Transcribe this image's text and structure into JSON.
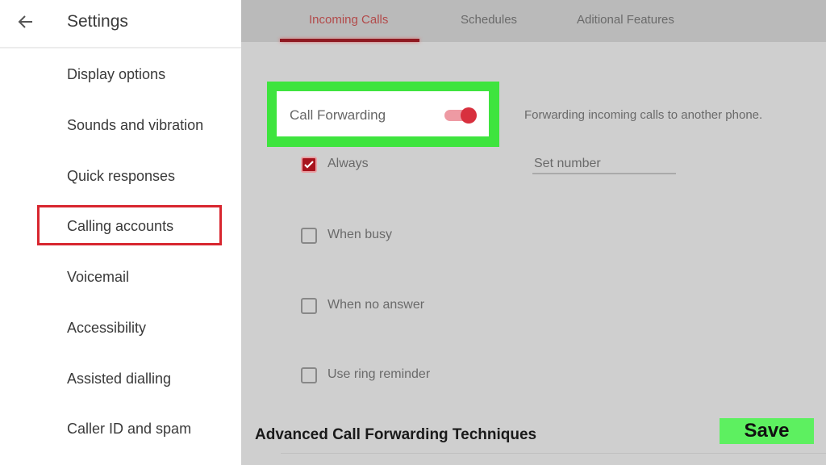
{
  "sidebar": {
    "title": "Settings",
    "back_icon": "arrow-left-icon",
    "items": [
      {
        "label": "Display options"
      },
      {
        "label": "Sounds and vibration"
      },
      {
        "label": "Quick responses"
      },
      {
        "label": "Calling accounts",
        "highlighted": true
      },
      {
        "label": "Voicemail"
      },
      {
        "label": "Accessibility"
      },
      {
        "label": "Assisted dialling"
      },
      {
        "label": "Caller ID and spam"
      }
    ]
  },
  "tabs": [
    {
      "label": "Incoming Calls",
      "active": true
    },
    {
      "label": "Schedules",
      "active": false
    },
    {
      "label": "Aditional Features",
      "active": false
    }
  ],
  "call_forwarding": {
    "label": "Call Forwarding",
    "enabled": true,
    "description": "Forwarding incoming calls to another phone.",
    "number_placeholder": "Set number"
  },
  "options": [
    {
      "label": "Always",
      "checked": true
    },
    {
      "label": "When busy",
      "checked": false
    },
    {
      "label": "When no answer",
      "checked": false
    },
    {
      "label": "Use ring reminder",
      "checked": false
    }
  ],
  "footer": {
    "title": "Advanced Call Forwarding Techniques",
    "save_label": "Save"
  },
  "colors": {
    "accent_red": "#d8303e",
    "highlight_green": "#3ee43e",
    "save_green": "#5df060"
  }
}
